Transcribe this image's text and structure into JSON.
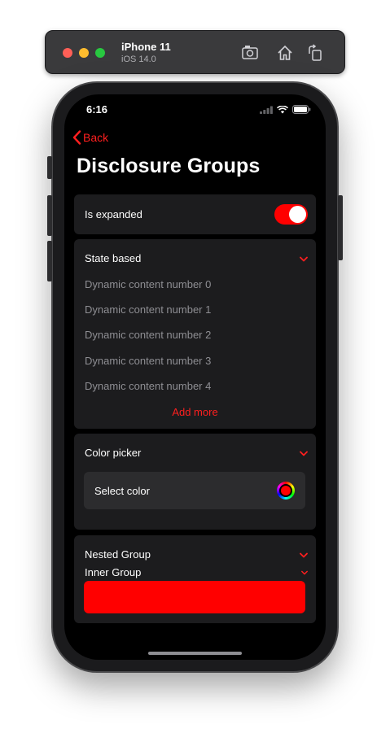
{
  "simulator": {
    "device_name": "iPhone 11",
    "os_version": "iOS 14.0",
    "toolbar_icons": [
      "screenshot-icon",
      "home-icon",
      "rotate-icon"
    ]
  },
  "status_bar": {
    "time": "6:16",
    "icons": [
      "cellular-icon",
      "wifi-icon",
      "battery-icon"
    ]
  },
  "nav": {
    "back_label": "Back",
    "title": "Disclosure Groups"
  },
  "expanded_card": {
    "label": "Is expanded",
    "toggle_on": true
  },
  "state_group": {
    "title": "State based",
    "items": [
      "Dynamic content number 0",
      "Dynamic content number 1",
      "Dynamic content number 2",
      "Dynamic content number 3",
      "Dynamic content number 4"
    ],
    "add_more_label": "Add more"
  },
  "color_group": {
    "title": "Color picker",
    "select_label": "Select color",
    "selected_color": "#ff0000"
  },
  "nested_group": {
    "title": "Nested Group",
    "inner_title": "Inner Group",
    "inner_color": "#ff0000"
  },
  "colors": {
    "accent": "#ff1f1f",
    "background": "#000000",
    "card": "#1c1c1e"
  }
}
